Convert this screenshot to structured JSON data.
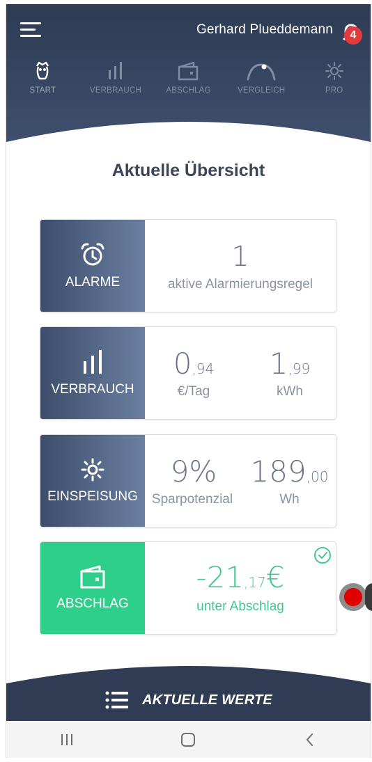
{
  "header": {
    "user_name": "Gerhard Plueddemann",
    "notification_count": "4"
  },
  "nav": [
    {
      "label": "START",
      "icon": "house-owl-icon"
    },
    {
      "label": "VERBRAUCH",
      "icon": "bars-icon"
    },
    {
      "label": "ABSCHLAG",
      "icon": "wallet-icon"
    },
    {
      "label": "VERGLEICH",
      "icon": "gauge-icon"
    },
    {
      "label": "PRO",
      "icon": "sun-icon"
    }
  ],
  "title": "Aktuelle Übersicht",
  "cards": {
    "alarme": {
      "label": "ALARME",
      "value": "1",
      "caption": "aktive Alarmierungsregel"
    },
    "verbrauch": {
      "label": "VERBRAUCH",
      "v1_int": "0",
      "v1_dec": ",94",
      "v1_unit": "€/Tag",
      "v2_int": "1",
      "v2_dec": ",99",
      "v2_unit": "kWh"
    },
    "einspeisung": {
      "label": "EINSPEISUNG",
      "v1": "9%",
      "v1_unit": "Sparpotenzial",
      "v2_int": "189",
      "v2_dec": ",00",
      "v2_unit": "Wh"
    },
    "abschlag": {
      "label": "ABSCHLAG",
      "value_int": "-21",
      "value_dec": ",17",
      "currency": "€",
      "caption": "unter Abschlag"
    }
  },
  "bottom": {
    "label": "AKTUELLE WERTE"
  },
  "colors": {
    "header_dark": "#34435e",
    "accent_green": "#2dcf8a",
    "badge_red": "#e33b3b"
  }
}
